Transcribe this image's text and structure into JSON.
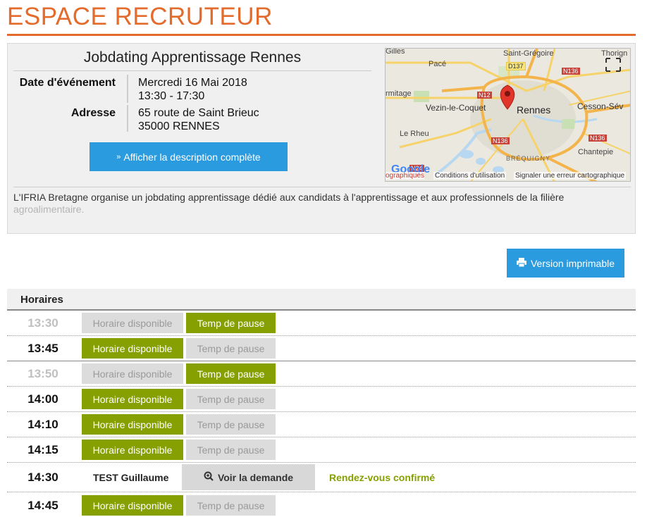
{
  "page": {
    "title": "ESPACE RECRUTEUR"
  },
  "event": {
    "title": "Jobdating Apprentissage Rennes",
    "date_label": "Date d'événement",
    "date": "Mercredi 16 Mai 2018",
    "time_range": "13:30 - 17:30",
    "address_label": "Adresse",
    "address_line1": "65 route de Saint Brieuc",
    "address_line2": "35000 RENNES",
    "desc_button": "Afficher la description complète",
    "description": "L'IFRIA Bretagne organise un jobdating apprentissage dédié aux candidats à l'apprentissage et aux professionnels de la filière",
    "description_cont": "agroalimentaire."
  },
  "map": {
    "labels": {
      "saint_gregoire": "Saint-Grégoire",
      "thorigne": "Thorign",
      "gilles": "Gilles",
      "pace": "Pacé",
      "d137": "D137",
      "n136_top": "N136",
      "n12": "N12",
      "ermitage": "rmitage",
      "vezin": "Vezin-le-Coquet",
      "rennes": "Rennes",
      "cesson": "Cesson-Sév",
      "le_rheu": "Le Rheu",
      "n136_mid": "N136",
      "n136_right": "N136",
      "chantepie": "Chantepie",
      "brequigny": "BRÉQUIGNY",
      "n24": "N24",
      "google": "Google",
      "geographiques": "ographiques",
      "conditions": "Conditions d'utilisation",
      "signaler": "Signaler une erreur cartographique"
    }
  },
  "actions": {
    "print_button": "Version imprimable"
  },
  "schedule": {
    "header": "Horaires",
    "slot_label": "Horaire disponible",
    "pause_label": "Temp de pause",
    "view_request": "Voir la demande",
    "rows": [
      {
        "time": "13:30",
        "slot_state": "off",
        "pause_state": "on"
      },
      {
        "time": "13:45",
        "slot_state": "on",
        "pause_state": "off"
      },
      {
        "time": "13:50",
        "slot_state": "off",
        "pause_state": "on"
      },
      {
        "time": "14:00",
        "slot_state": "on",
        "pause_state": "off"
      },
      {
        "time": "14:10",
        "slot_state": "on",
        "pause_state": "off"
      },
      {
        "time": "14:15",
        "slot_state": "on",
        "pause_state": "off"
      },
      {
        "time": "14:30",
        "candidate": "TEST Guillaume",
        "status": "Rendez-vous confirmé"
      },
      {
        "time": "14:45",
        "slot_state": "on",
        "pause_state": "off"
      }
    ]
  },
  "colors": {
    "accent_orange": "#e36b2c",
    "button_blue": "#2b9be0",
    "active_green": "#85a000",
    "inactive_gray": "#dcdcdc"
  },
  "icons": {
    "desc_button": "chevron-double-down-icon",
    "print_button": "printer-icon",
    "view_request": "zoom-in-icon",
    "map_marker": "map-pin-icon",
    "map_fullscreen": "fullscreen-icon"
  }
}
